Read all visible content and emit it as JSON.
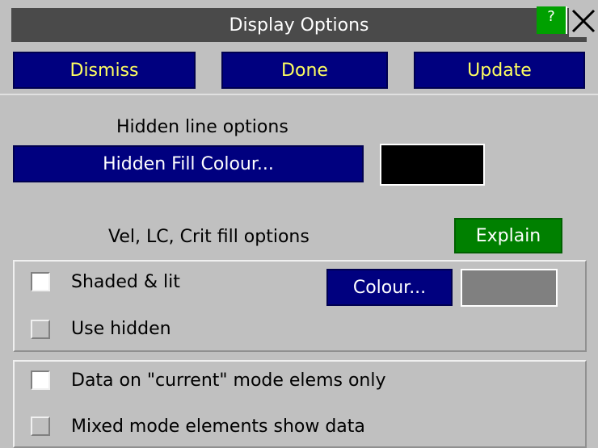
{
  "window": {
    "title": "Display Options",
    "help_label": "?",
    "close_label": "✕"
  },
  "toolbar": {
    "dismiss_label": "Dismiss",
    "done_label": "Done",
    "update_label": "Update"
  },
  "hidden": {
    "heading": "Hidden line options",
    "fill_colour_label": "Hidden Fill Colour...",
    "fill_colour_value": "#000000"
  },
  "vel": {
    "heading": "Vel, LC, Crit fill options",
    "explain_label": "Explain",
    "shaded_label": "Shaded & lit",
    "shaded_checked": false,
    "colour_label": "Colour...",
    "colour_value": "#808080",
    "use_hidden_label": "Use hidden",
    "use_hidden_enabled": false
  },
  "modes": {
    "current_only_label": "Data on \"current\" mode elems only",
    "current_only_checked": false,
    "mixed_label": "Mixed mode elements show data",
    "mixed_enabled": false
  }
}
